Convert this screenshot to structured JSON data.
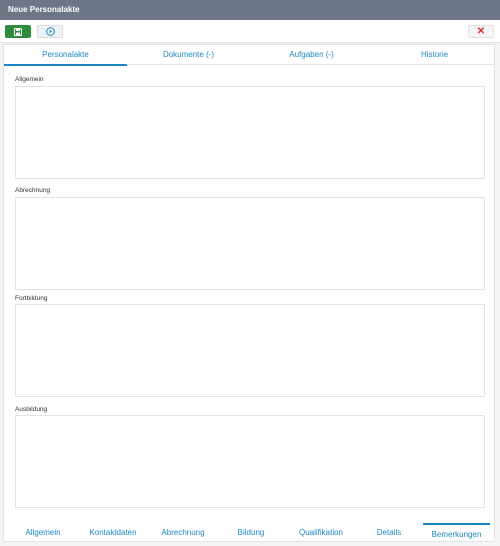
{
  "window": {
    "title": "Neue Personalakte"
  },
  "toolbar": {
    "save_icon": "floppy-disk-icon",
    "play_icon": "play-circle-icon",
    "close_label": "✕",
    "accent_save": "#2e8b3e",
    "accent_close": "#d0312d"
  },
  "tabs": [
    {
      "label": "Personalakte",
      "active": true
    },
    {
      "label": "Dokumente (-)",
      "active": false
    },
    {
      "label": "Aufgaben (-)",
      "active": false
    },
    {
      "label": "Historie",
      "active": false
    }
  ],
  "sections": [
    {
      "label": "Allgemein",
      "value": ""
    },
    {
      "label": "Abrechnung",
      "value": ""
    },
    {
      "label": "Fortbildung",
      "value": ""
    },
    {
      "label": "Ausbildung",
      "value": ""
    }
  ],
  "bottom_tabs": [
    {
      "label": "Allgemein",
      "active": false
    },
    {
      "label": "Kontaktdaten",
      "active": false
    },
    {
      "label": "Abrechnung",
      "active": false
    },
    {
      "label": "Bildung",
      "active": false
    },
    {
      "label": "Qualifikation",
      "active": false
    },
    {
      "label": "Details",
      "active": false
    },
    {
      "label": "Bemerkungen",
      "active": true
    }
  ],
  "colors": {
    "title_bar": "#6c7684",
    "link": "#1d87c5"
  }
}
